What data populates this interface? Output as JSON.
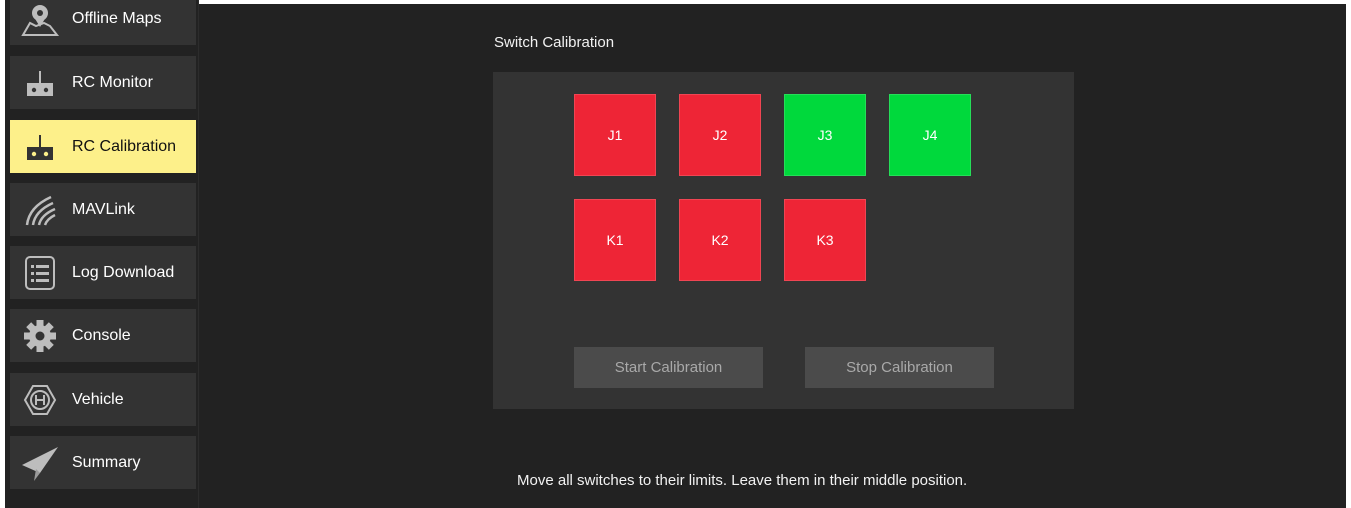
{
  "sidebar": {
    "items": [
      {
        "label": "Offline Maps",
        "icon": "map-pin-icon"
      },
      {
        "label": "RC Monitor",
        "icon": "rc-transmitter-icon"
      },
      {
        "label": "RC Calibration",
        "icon": "rc-transmitter-icon",
        "active": true
      },
      {
        "label": "MAVLink",
        "icon": "signal-waves-icon"
      },
      {
        "label": "Log Download",
        "icon": "list-icon"
      },
      {
        "label": "Console",
        "icon": "gear-icon"
      },
      {
        "label": "Vehicle",
        "icon": "hexagon-h-icon"
      },
      {
        "label": "Summary",
        "icon": "paper-plane-icon"
      }
    ]
  },
  "main": {
    "title": "Switch Calibration",
    "switches": [
      {
        "label": "J1",
        "state": "uncalibrated"
      },
      {
        "label": "J2",
        "state": "uncalibrated"
      },
      {
        "label": "J3",
        "state": "calibrated"
      },
      {
        "label": "J4",
        "state": "calibrated"
      },
      {
        "label": "K1",
        "state": "uncalibrated"
      },
      {
        "label": "K2",
        "state": "uncalibrated"
      },
      {
        "label": "K3",
        "state": "uncalibrated"
      }
    ],
    "start_button": "Start Calibration",
    "stop_button": "Stop Calibration",
    "instructions": "Move all switches to their limits. Leave them in their middle position."
  },
  "colors": {
    "background": "#222222",
    "panel": "#333333",
    "active_item": "#fdf08a",
    "uncalibrated": "#ee2536",
    "calibrated": "#00d93c",
    "button": "#4b4b4b",
    "button_text": "#a9a9a9"
  }
}
